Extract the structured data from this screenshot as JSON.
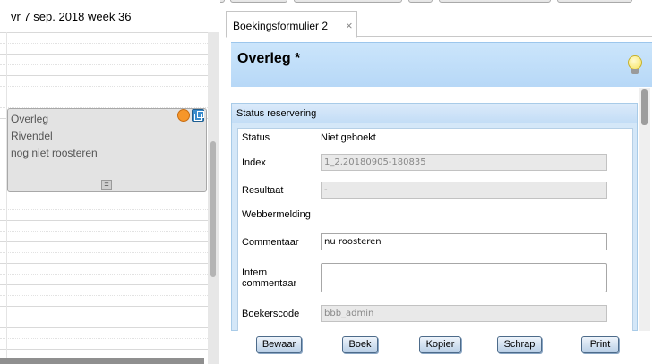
{
  "calendar": {
    "date_label": "vr 7 sep. 2018 week 36",
    "appointment": {
      "line1": "Overleg",
      "line2": "Rivendel",
      "line3": "nog niet roosteren",
      "resize_glyph": "=",
      "status_color": "#f6962a"
    }
  },
  "tab": {
    "label": "Boekingsformulier 2",
    "close_glyph": "×"
  },
  "form": {
    "title": "Overleg *",
    "section_title": "Status reservering",
    "fields": {
      "status_label": "Status",
      "status_value": "Niet geboekt",
      "index_label": "Index",
      "index_value": "1_2.20180905-180835",
      "resultaat_label": "Resultaat",
      "resultaat_value": "-",
      "webbermelding_label": "Webbermelding",
      "commentaar_label": "Commentaar",
      "commentaar_value": "nu roosteren",
      "intern_label_1": "Intern",
      "intern_label_2": "commentaar",
      "intern_value": "",
      "boekerscode_label": "Boekerscode",
      "boekerscode_value": "bbb_admin"
    }
  },
  "buttons": {
    "bewaar": "Bewaar",
    "boek": "Boek",
    "kopier": "Kopier",
    "schrap": "Schrap",
    "print": "Print"
  },
  "icons": {
    "status": "orange-dot-icon",
    "open": "open-window-icon",
    "hint": "lightbulb-icon"
  },
  "colors": {
    "header_blue": "#b7d8f7",
    "button_blue": "#b9cfe6",
    "appointment_bg": "#e3e3e3"
  }
}
